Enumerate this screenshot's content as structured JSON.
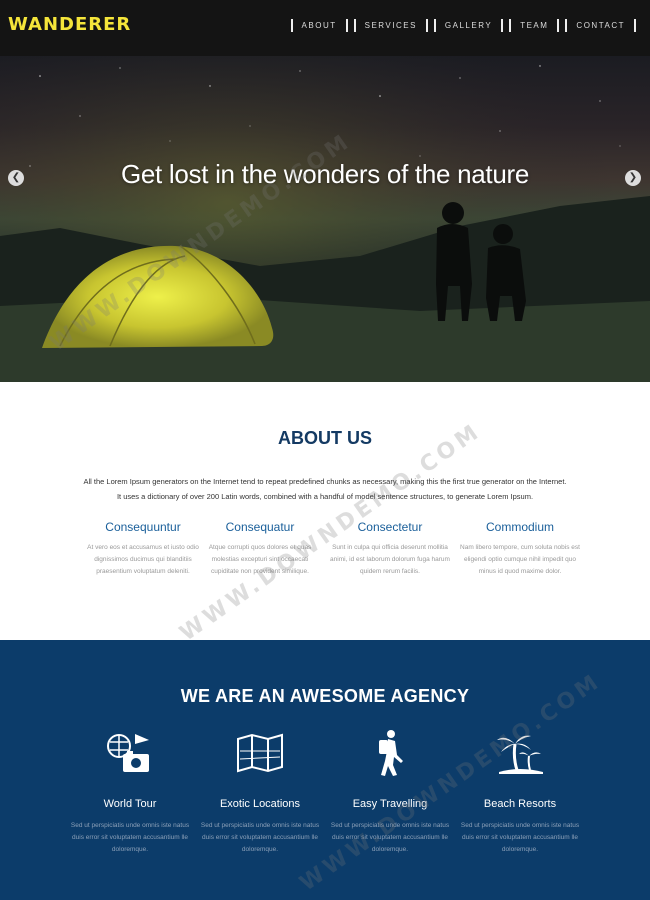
{
  "header": {
    "logo": "WANDERER",
    "nav": [
      "ABOUT",
      "SERVICES",
      "GALLERY",
      "TEAM",
      "CONTACT"
    ]
  },
  "hero": {
    "title": "Get lost in the wonders of the nature",
    "prev_icon": "chevron-left-icon",
    "next_icon": "chevron-right-icon"
  },
  "about": {
    "title": "ABOUT US",
    "text": "All the Lorem Ipsum generators on the Internet tend to repeat predefined chunks as necessary, making this the first true generator on the Internet. It uses a dictionary of over 200 Latin words, combined with a handful of model sentence structures, to generate Lorem Ipsum.",
    "features": [
      {
        "title": "Consequuntur",
        "text": "At vero eos et accusamus et iusto odio dignissimos ducimus qui blanditiis praesentium voluptatum deleniti."
      },
      {
        "title": "Consequatur",
        "text": "Atque corrupti quos dolores et quas molestias excepturi sint occaecati cupiditate non provident similique."
      },
      {
        "title": "Consectetur",
        "text": "Sunt in culpa qui officia deserunt mollitia animi, id est laborum dolorum fuga harum quidem rerum facilis."
      },
      {
        "title": "Commodium",
        "text": "Nam libero tempore, cum soluta nobis est eligendi optio cumque nihil impedit quo minus id quod maxime dolor."
      }
    ]
  },
  "agency": {
    "title": "WE ARE AN AWESOME AGENCY",
    "services": [
      {
        "icon": "world-tour-icon",
        "title": "World Tour",
        "text": "Sed ut perspiciatis unde omnis iste natus duis error sit voluptatem accusantium lle doloremque."
      },
      {
        "icon": "map-icon",
        "title": "Exotic Locations",
        "text": "Sed ut perspiciatis unde omnis iste natus duis error sit voluptatem accusantium lle doloremque."
      },
      {
        "icon": "hiker-icon",
        "title": "Easy Travelling",
        "text": "Sed ut perspiciatis unde omnis iste natus duis error sit voluptatem accusantium lle doloremque."
      },
      {
        "icon": "palm-tree-icon",
        "title": "Beach Resorts",
        "text": "Sed ut perspiciatis unde omnis iste natus duis error sit voluptatem accusantium lle doloremque."
      }
    ]
  },
  "watermark": "WWW.DOWNDEMO.COM",
  "colors": {
    "header_bg": "#141414",
    "logo": "#f5e53a",
    "agency_bg": "#0c3c6a",
    "about_title": "#143a63",
    "feature_title": "#1a5f9a"
  }
}
